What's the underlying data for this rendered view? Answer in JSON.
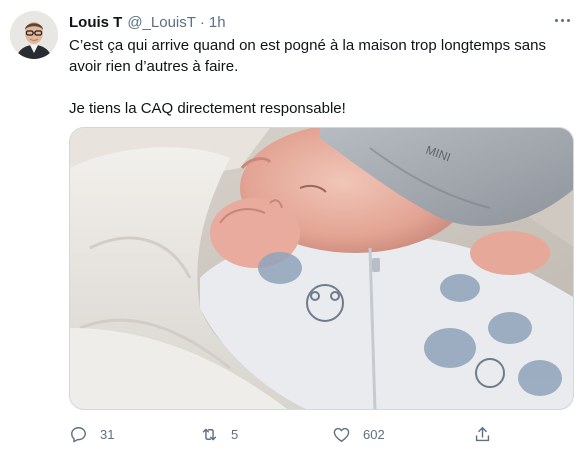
{
  "tweet": {
    "author_name": "Louis T",
    "handle": "@_LouisT",
    "separator": "·",
    "time": "1h",
    "text_line1": "C’est ça qui arrive quand on est pogné à la maison trop longtemps sans",
    "text_line2": "avoir rien d’autres à faire.",
    "text_line3": "Je tiens la CAQ directement responsable!",
    "image_caption_text": "MINI",
    "replies": "31",
    "retweets": "5",
    "likes": "602"
  },
  "icons": {
    "more": "more-dots-icon",
    "reply": "reply-icon",
    "retweet": "retweet-icon",
    "like": "heart-icon",
    "share": "share-icon"
  },
  "colors": {
    "secondary_text": "#5b7083",
    "primary_text": "#0f1419",
    "border": "#cfd9de"
  }
}
